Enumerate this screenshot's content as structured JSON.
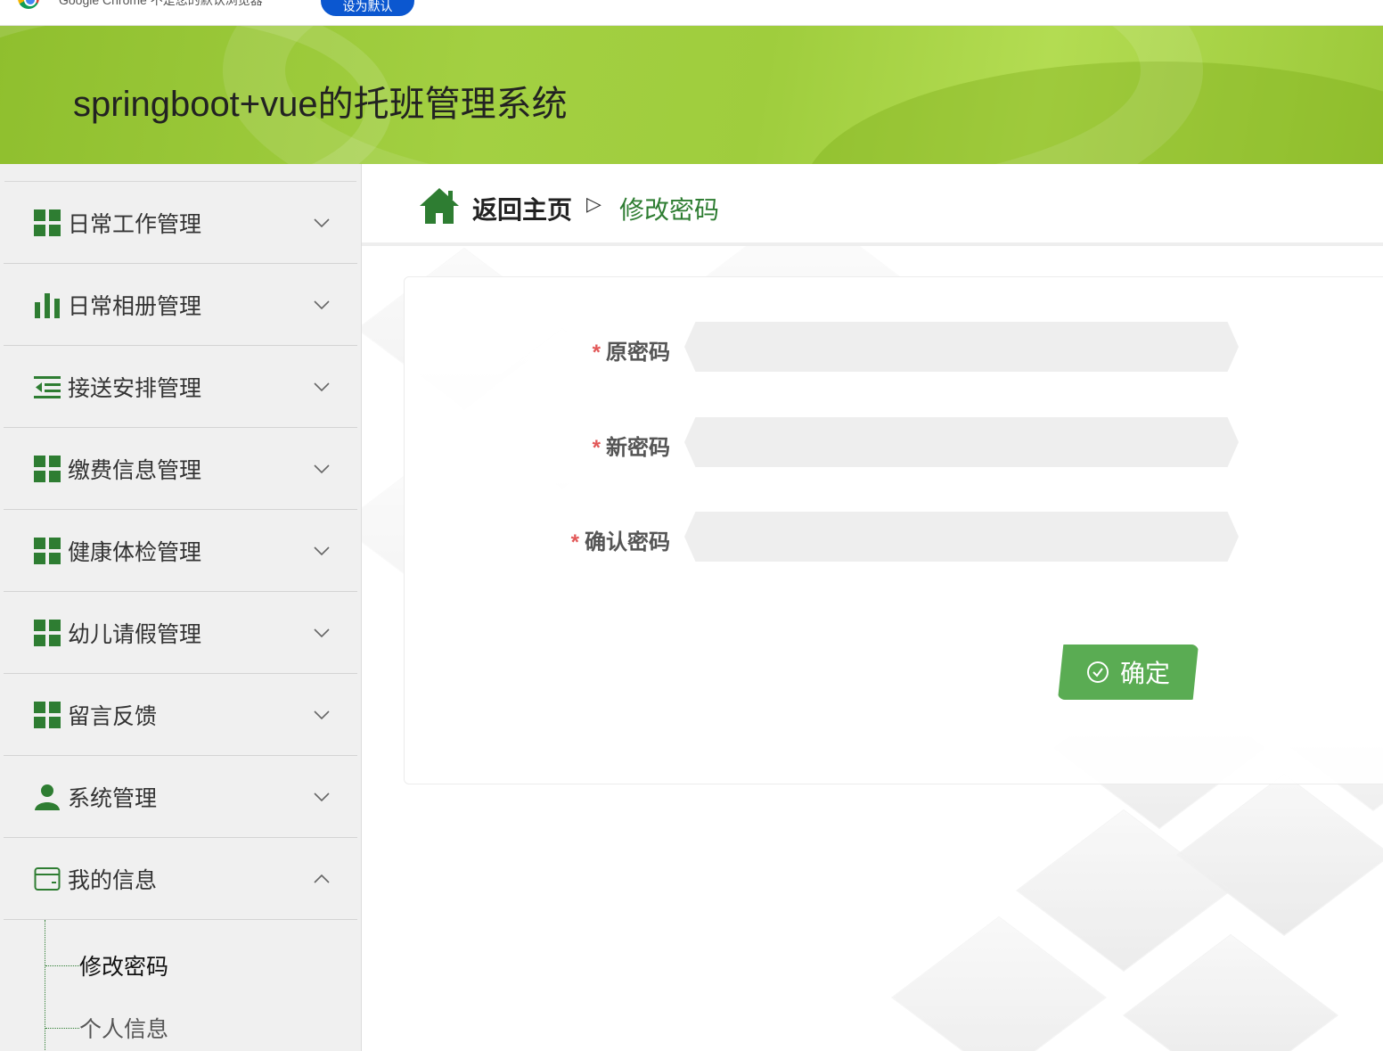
{
  "browser_notice": {
    "text": "Google Chrome 不是您的默认浏览器",
    "button": "设为默认"
  },
  "header": {
    "title": "springboot+vue的托班管理系统"
  },
  "sidebar": {
    "items": [
      {
        "label": "日常工作管理",
        "icon": "grid-icon",
        "expanded": false
      },
      {
        "label": "日常相册管理",
        "icon": "bar-chart-icon",
        "expanded": false
      },
      {
        "label": "接送安排管理",
        "icon": "list-indent-icon",
        "expanded": false
      },
      {
        "label": "缴费信息管理",
        "icon": "grid-icon",
        "expanded": false
      },
      {
        "label": "健康体检管理",
        "icon": "grid-icon",
        "expanded": false
      },
      {
        "label": "幼儿请假管理",
        "icon": "grid-icon",
        "expanded": false
      },
      {
        "label": "留言反馈",
        "icon": "grid-icon",
        "expanded": false
      },
      {
        "label": "系统管理",
        "icon": "user-icon",
        "expanded": false
      },
      {
        "label": "我的信息",
        "icon": "wallet-icon",
        "expanded": true
      }
    ],
    "submenu": [
      {
        "label": "修改密码",
        "active": true
      },
      {
        "label": "个人信息",
        "active": false
      }
    ]
  },
  "breadcrumb": {
    "home": "返回主页",
    "separator": "▷",
    "current": "修改密码"
  },
  "form": {
    "required_mark": "*",
    "fields": [
      {
        "label": "原密码",
        "value": ""
      },
      {
        "label": "新密码",
        "value": ""
      },
      {
        "label": "确认密码",
        "value": ""
      }
    ],
    "submit": "确定"
  },
  "colors": {
    "accent_green": "#2e7d32",
    "button_green": "#5aac53",
    "banner_green": "#a3d042",
    "required_red": "#e25858"
  }
}
